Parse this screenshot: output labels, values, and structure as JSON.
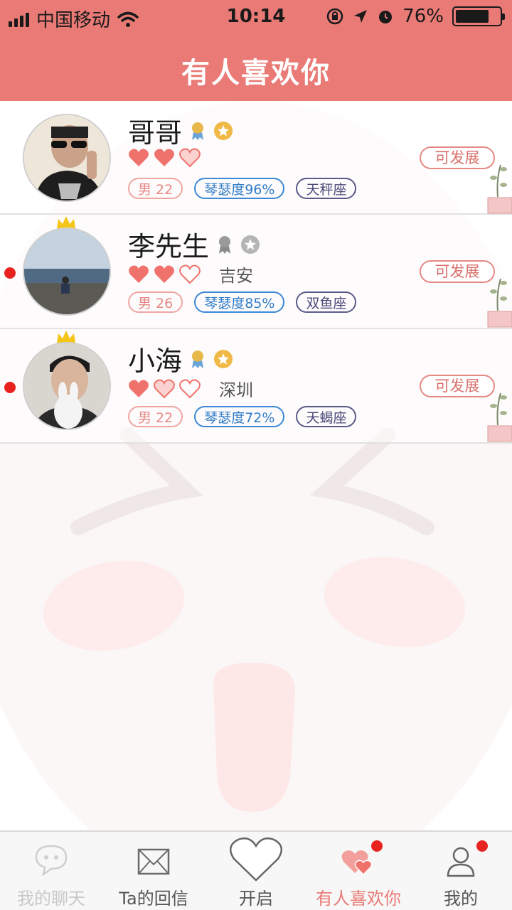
{
  "status_bar": {
    "carrier": "中国移动",
    "time": "10:14",
    "battery_percent": "76%",
    "battery_level": 0.76,
    "icons": [
      "signal-icon",
      "wifi-icon",
      "rotation-lock-icon",
      "location-arrow-icon",
      "alarm-icon",
      "battery-icon"
    ]
  },
  "header": {
    "title": "有人喜欢你"
  },
  "users": [
    {
      "name": "哥哥",
      "hearts": [
        "full",
        "full",
        "half"
      ],
      "city": "",
      "gender_age": "男 22",
      "match": "琴瑟度96%",
      "zodiac": "天秤座",
      "crown": false,
      "unread": false,
      "medal_color": "gold",
      "star_color": "gold",
      "action_label": "可发展"
    },
    {
      "name": "李先生",
      "hearts": [
        "full",
        "full",
        "empty"
      ],
      "city": "吉安",
      "gender_age": "男 26",
      "match": "琴瑟度85%",
      "zodiac": "双鱼座",
      "crown": true,
      "unread": true,
      "medal_color": "gray",
      "star_color": "gray",
      "action_label": "可发展"
    },
    {
      "name": "小海",
      "hearts": [
        "full",
        "half",
        "empty"
      ],
      "city": "深圳",
      "gender_age": "男 22",
      "match": "琴瑟度72%",
      "zodiac": "天蝎座",
      "crown": true,
      "unread": true,
      "medal_color": "gold",
      "star_color": "gold",
      "action_label": "可发展"
    }
  ],
  "tabs": [
    {
      "label": "我的聊天",
      "icon": "chat-bubble-icon",
      "active": false,
      "badge": false
    },
    {
      "label": "Ta的回信",
      "icon": "envelope-icon",
      "active": false,
      "badge": false
    },
    {
      "label": "开启",
      "icon": "heart-outline-icon",
      "active": false,
      "badge": false
    },
    {
      "label": "有人喜欢你",
      "icon": "double-heart-icon",
      "active": true,
      "badge": true
    },
    {
      "label": "我的",
      "icon": "person-icon",
      "active": false,
      "badge": true
    }
  ],
  "colors": {
    "brand": "#e97a76",
    "active_tab": "#e97a76",
    "inactive_tab": "#555555",
    "heart": "#f0726d",
    "badge": "#e8231f",
    "match_tag": "#3a88d6",
    "zodiac_tag": "#5a5a8a"
  }
}
